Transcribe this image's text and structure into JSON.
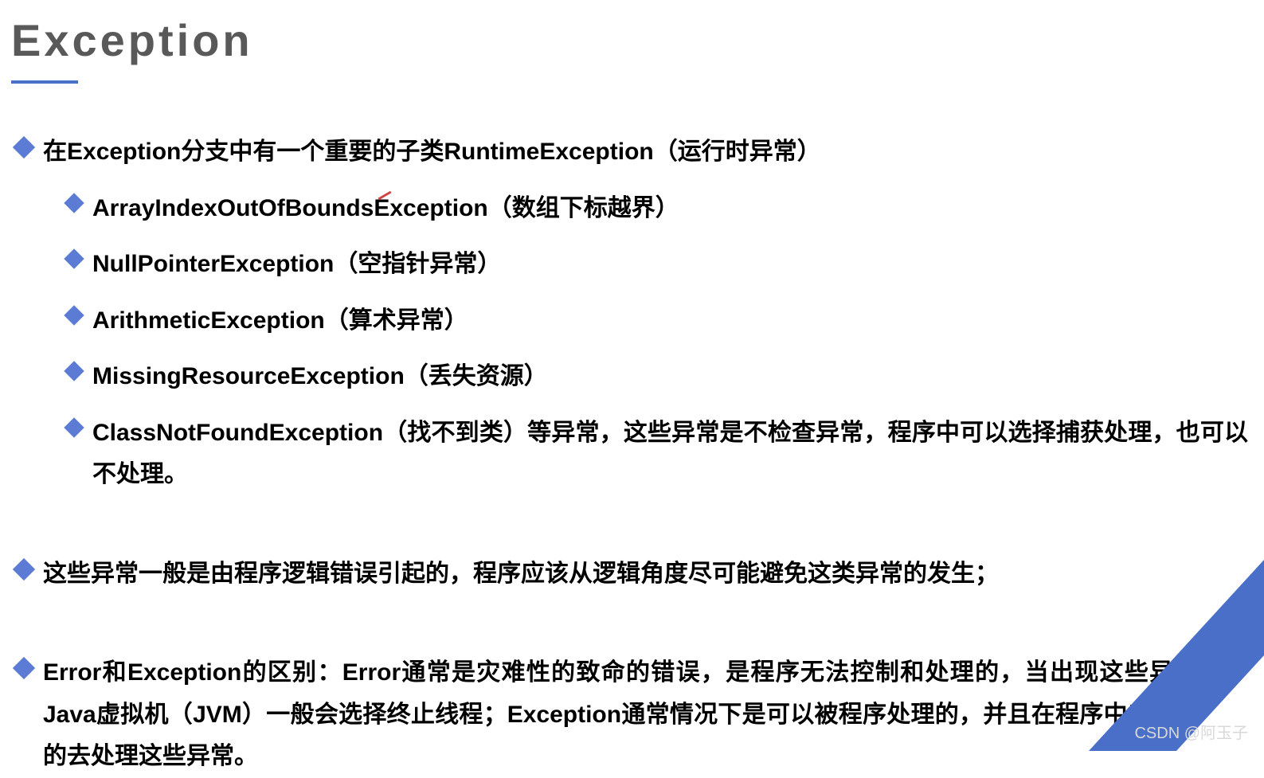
{
  "title": "Exception",
  "bullets": {
    "l1_1": "在Exception分支中有一个重要的子类RuntimeException（运行时异常）",
    "l2_1": "ArrayIndexOutOfBoundsException（数组下标越界）",
    "l2_2": "NullPointerException（空指针异常）",
    "l2_3": "ArithmeticException（算术异常）",
    "l2_4": "MissingResourceException（丢失资源）",
    "l2_5": "ClassNotFoundException（找不到类）等异常，这些异常是不检查异常，程序中可以选择捕获处理，也可以不处理。",
    "l1_2": "这些异常一般是由程序逻辑错误引起的，程序应该从逻辑角度尽可能避免这类异常的发生；",
    "l1_3": "Error和Exception的区别：Error通常是灾难性的致命的错误，是程序无法控制和处理的，当出现这些异常时，Java虚拟机（JVM）一般会选择终止线程；Exception通常情况下是可以被程序处理的，并且在程序中应该尽可能的去处理这些异常。"
  },
  "watermark": "CSDN @阿玉子"
}
